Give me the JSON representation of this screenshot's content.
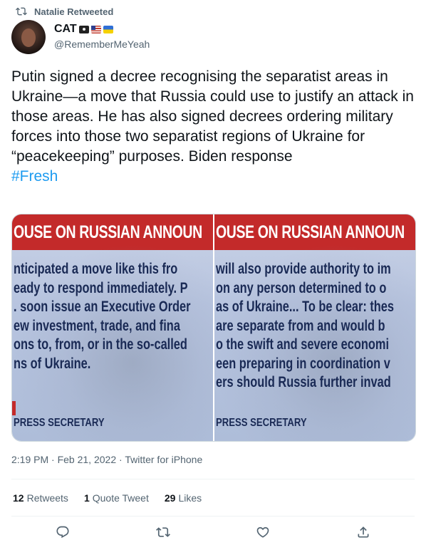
{
  "retweet": {
    "label": "Natalie Retweeted"
  },
  "author": {
    "name": "CAT",
    "handle": "@RememberMeYeah"
  },
  "tweet": {
    "text": "Putin signed a decree recognising the separatist areas in Ukraine—a move that Russia could use to justify an attack in those areas. He has also signed decrees ordering military forces into those two separatist regions of Ukraine for “peacekeeping” purposes. Biden response",
    "hashtag": "#Fresh"
  },
  "media": {
    "left": {
      "banner": "OUSE ON RUSSIAN ANNOUN",
      "lines": [
        "nticipated a move like this fro",
        "eady to respond immediately. P",
        ". soon issue an Executive Order",
        "ew investment, trade, and fina",
        "ons to, from, or in the so-called",
        "ns of Ukraine."
      ],
      "footer": "PRESS SECRETARY"
    },
    "right": {
      "banner": "OUSE ON RUSSIAN ANNOUN",
      "lines": [
        "will also provide authority to im",
        "on any person determined to o",
        "as of Ukraine... To be clear: thes",
        "are separate from and would b",
        "o the swift and severe economi",
        "een preparing in coordination v",
        "ers should Russia further invad"
      ],
      "footer": "PRESS SECRETARY"
    }
  },
  "meta": {
    "time": "2:19 PM",
    "date": "Feb 21, 2022",
    "source": "Twitter for iPhone",
    "separator": "·"
  },
  "stats": {
    "retweets": {
      "count": "12",
      "label": "Retweets"
    },
    "quotes": {
      "count": "1",
      "label": "Quote Tweet"
    },
    "likes": {
      "count": "29",
      "label": "Likes"
    }
  },
  "icons": {
    "retweet": "retweet-icon",
    "reply": "reply-icon",
    "like": "heart-icon",
    "share": "share-icon"
  },
  "colors": {
    "accent": "#1d9bf0",
    "text": "#0f1419",
    "muted": "#536471",
    "banner_red": "#c32a2a"
  }
}
